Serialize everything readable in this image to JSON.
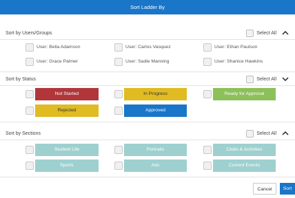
{
  "header": {
    "title": "Sort Ladder By"
  },
  "sections": {
    "users": {
      "title": "Sort by Users/Groups",
      "select_all": "Select All",
      "items": [
        "User: Bella Adamson",
        "User: Carlos Vasquez",
        "User: Ethan Paulson",
        "User: Grace Palmer",
        "User: Sadie Manning",
        "User: Shanice Hawkins"
      ]
    },
    "status": {
      "title": "Sort by Status",
      "select_all": "Select All",
      "items": [
        {
          "label": "Not Started",
          "color": "#b0363a"
        },
        {
          "label": "In Progress",
          "color": "#e0bb22"
        },
        {
          "label": "Ready for Approval",
          "color": "#8cc05a"
        },
        {
          "label": "Rejected",
          "color": "#e0bb22"
        },
        {
          "label": "Approved",
          "color": "#1976c9"
        }
      ]
    },
    "sections": {
      "title": "Sort by Sections",
      "select_all": "Select All",
      "items": [
        "Student Life",
        "Portraits",
        "Clubs & Activities",
        "Sports",
        "Ads",
        "Current Events"
      ],
      "color": "#9ed0cf"
    }
  },
  "footer": {
    "cancel": "Cancel",
    "sort": "Sort"
  },
  "icons": {
    "collapse": "chevron-up-icon",
    "expand": "chevron-down-icon"
  }
}
